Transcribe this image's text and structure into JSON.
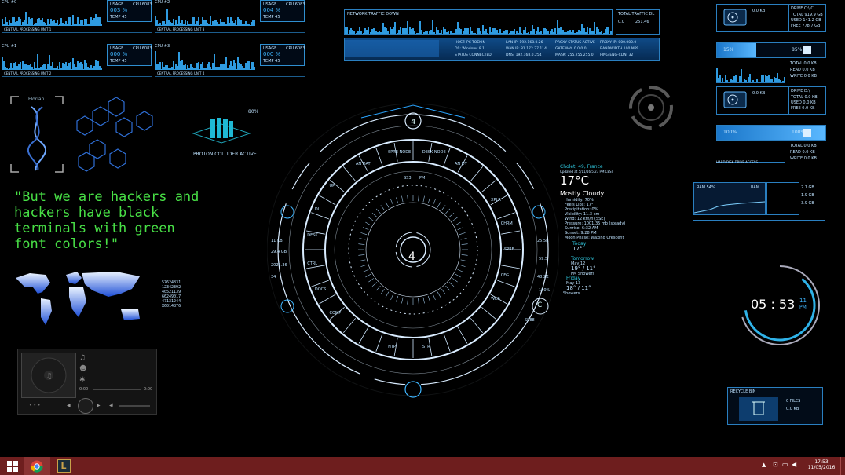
{
  "cpu_cards": [
    {
      "title": "CPU #0",
      "usage_label": "USAGE",
      "usage": "003 %",
      "temp": "TEMP 45",
      "model_label": "CPU 6083",
      "foot": "CENTRAL PROCESSING UNIT 1"
    },
    {
      "title": "CPU #2",
      "usage_label": "USAGE",
      "usage": "004 %",
      "temp": "TEMP 45",
      "model_label": "CPU 6083",
      "foot": "CENTRAL PROCESSING UNIT 3"
    },
    {
      "title": "CPU #1",
      "usage_label": "USAGE",
      "usage": "000 %",
      "temp": "TEMP 45",
      "model_label": "CPU 6083",
      "foot": "CENTRAL PROCESSING UNIT 2"
    },
    {
      "title": "CPU #3",
      "usage_label": "USAGE",
      "usage": "000 %",
      "temp": "TEMP 45",
      "model_label": "CPU 6083",
      "foot": "CENTRAL PROCESSING UNIT 4"
    }
  ],
  "network": {
    "title": "NETWORK TRAFFIC DOWN",
    "total_label": "TOTAL TRAFFIC DL",
    "total_value": "251.46",
    "total_zero": "0.0",
    "rows": [
      [
        "HOST: PC-TOEKIN",
        "LAN IP: 192.168.0.26",
        "PROXY STATUS ACTIVE",
        "PROXY IP: 000.000.0"
      ],
      [
        "OS: Windows 8.1",
        "WAN IP: 81.172.27.114",
        "GATEWAY: 0.0.0.0",
        "BANDWIDTH 100 MPS"
      ],
      [
        "STATUS CONNECTED",
        "DNS: 192.168.0.254",
        "MASK: 255.255.255.0",
        "PING ENG-CDN: 32"
      ]
    ]
  },
  "drives": [
    {
      "label": "DRIVE C:\\ CL",
      "total": "TOTAL 919.9 GB",
      "used": "USED 141.2 GB",
      "free": "FREE 778.7 GB",
      "percent": "15%",
      "percent2": "85%",
      "usage": "0.0 KB",
      "read": "READ 0.0 KB",
      "write": "WRITE 0.0 KB",
      "total_small": "TOTAL 0.0 KB",
      "footer": "HARD DISK DRIVE ACCESS"
    },
    {
      "label": "DRIVE D:\\",
      "total": "TOTAL 0.0 KB",
      "used": "USED 0.0 KB",
      "free": "FREE 0.0 KB",
      "percent": "100%",
      "percent2": "100%",
      "usage": "0.0 KB",
      "read": "READ 0.0 KB",
      "write": "WRITE 0.0 KB",
      "total_small": "TOTAL 0.0 KB",
      "footer": "HARD DISK DRIVE ACCESS"
    }
  ],
  "dna_label": "Florian",
  "proton": {
    "percent": "80%",
    "label": "PROTON COLLIDER ACTIVE"
  },
  "quote": "\"But we are hackers and\nhackers have black\nterminals with green\nfont colors!\"",
  "map_numbers": [
    "57624831",
    "12342392",
    "40521139",
    "66249017",
    "47131244",
    "X6014876"
  ],
  "weather": {
    "location": "Cholet, 49, France",
    "updated": "Updated at 5/11/16 5:23 PM CEST",
    "temp": "17°C",
    "condition": "Mostly Cloudy",
    "details": [
      "Humidity: 70%",
      "Feels Like: 17°",
      "Precipitation: 0%",
      "Visibility: 11.3 km",
      "Wind: 12 km/h (SSE)",
      "Pressure: 1001.35 mb (steady)",
      "Sunrise: 6:32 AM",
      "Sunset: 9:28 PM",
      "Moon Phase: Waxing Crescent"
    ],
    "today_label": "Today",
    "today_temp": "17°",
    "tomorrow_label": "Tomorrow",
    "tomorrow_date": "May 12",
    "tomorrow_temp": "19° / 11°",
    "tomorrow_cond": "PM Showers",
    "friday_label": "Friday",
    "friday_date": "May 13",
    "friday_temp": "18° / 11°",
    "friday_cond": "Showers"
  },
  "hud": {
    "center_digit": "4",
    "top_digit": "4",
    "bottom_letter": "C",
    "right_labels": [
      "25.5K",
      "59.5",
      "48.2K",
      "100%"
    ],
    "left_labels": [
      "11 KB",
      "29.4 GB",
      "2025.36",
      "34"
    ],
    "ring_items_left": [
      "COMP",
      "DOCS",
      "CTRL",
      "DESK",
      "DL",
      "UP"
    ],
    "ring_items_right": [
      "XPLR",
      "CHRM",
      "SPRE",
      "CFG",
      "WEB"
    ],
    "ring_items_top": [
      "AN DAT",
      "SPRE NODE",
      "DESK NODE",
      "AN DT"
    ],
    "ring_items_bottom": [
      "STR",
      "NTP"
    ],
    "top_value": "SS3",
    "top_value2": "PM",
    "right_small": "SS88"
  },
  "ram": {
    "label": "RAM",
    "sub": "RAM 54%",
    "values": [
      "2.1 GB",
      "1.9 GB",
      "3.9 GB"
    ]
  },
  "clock": {
    "hours": "05",
    "minutes": "53",
    "seconds": "11",
    "ampm": "PM"
  },
  "recycle": {
    "title": "RECYCLE BIN",
    "values": [
      "0 FILES",
      "0.0 KB"
    ]
  },
  "media": {
    "time_start": "0:00",
    "time_end": "0:00",
    "time_start2": "0:00",
    "time_end2": "0:00"
  },
  "taskbar": {
    "time": "17:53",
    "date": "11/05/2016"
  },
  "accent": "#3fb6ff",
  "green": "#48e046",
  "taskbar_color": "#6e1e1e"
}
